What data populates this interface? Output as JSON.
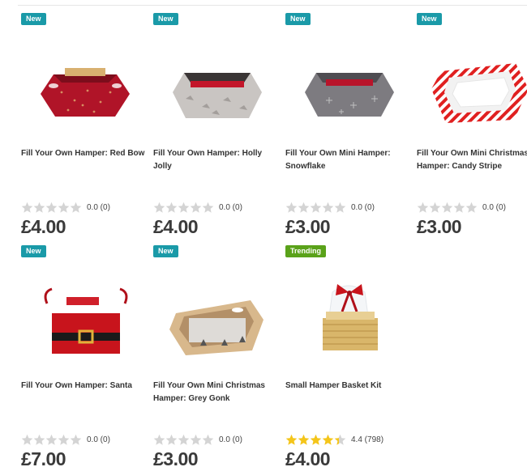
{
  "products": [
    {
      "badge": "New",
      "badge_type": "new",
      "title": "Fill Your Own Hamper: Red Bow",
      "rating_stars": 0,
      "rating_text": "0.0 (0)",
      "price": "£4.00",
      "image": "red-bow-hamper"
    },
    {
      "badge": "New",
      "badge_type": "new",
      "title": "Fill Your Own Hamper: Holly Jolly",
      "rating_stars": 0,
      "rating_text": "0.0 (0)",
      "price": "£4.00",
      "image": "holly-jolly-hamper"
    },
    {
      "badge": "New",
      "badge_type": "new",
      "title": "Fill Your Own Mini Hamper: Snowflake",
      "rating_stars": 0,
      "rating_text": "0.0 (0)",
      "price": "£3.00",
      "image": "snowflake-hamper"
    },
    {
      "badge": "New",
      "badge_type": "new",
      "title": "Fill Your Own Mini Christmas Hamper: Candy Stripe",
      "rating_stars": 0,
      "rating_text": "0.0 (0)",
      "price": "£3.00",
      "image": "candy-stripe-hamper"
    },
    {
      "badge": "New",
      "badge_type": "new",
      "title": "Fill Your Own Hamper: Santa",
      "rating_stars": 0,
      "rating_text": "0.0 (0)",
      "price": "£7.00",
      "image": "santa-hamper"
    },
    {
      "badge": "New",
      "badge_type": "new",
      "title": "Fill Your Own Mini Christmas Hamper: Grey Gonk",
      "rating_stars": 0,
      "rating_text": "0.0 (0)",
      "price": "£3.00",
      "image": "grey-gonk-hamper"
    },
    {
      "badge": "Trending",
      "badge_type": "trending",
      "title": "Small Hamper Basket Kit",
      "rating_stars": 4.4,
      "rating_text": "4.4 (798)",
      "price": "£4.00",
      "image": "basket-kit"
    }
  ],
  "colors": {
    "star_empty": "#d4d4d4",
    "star_full": "#f4c51a",
    "badge_new": "#1a9aa8",
    "badge_trending": "#5aa21a"
  }
}
